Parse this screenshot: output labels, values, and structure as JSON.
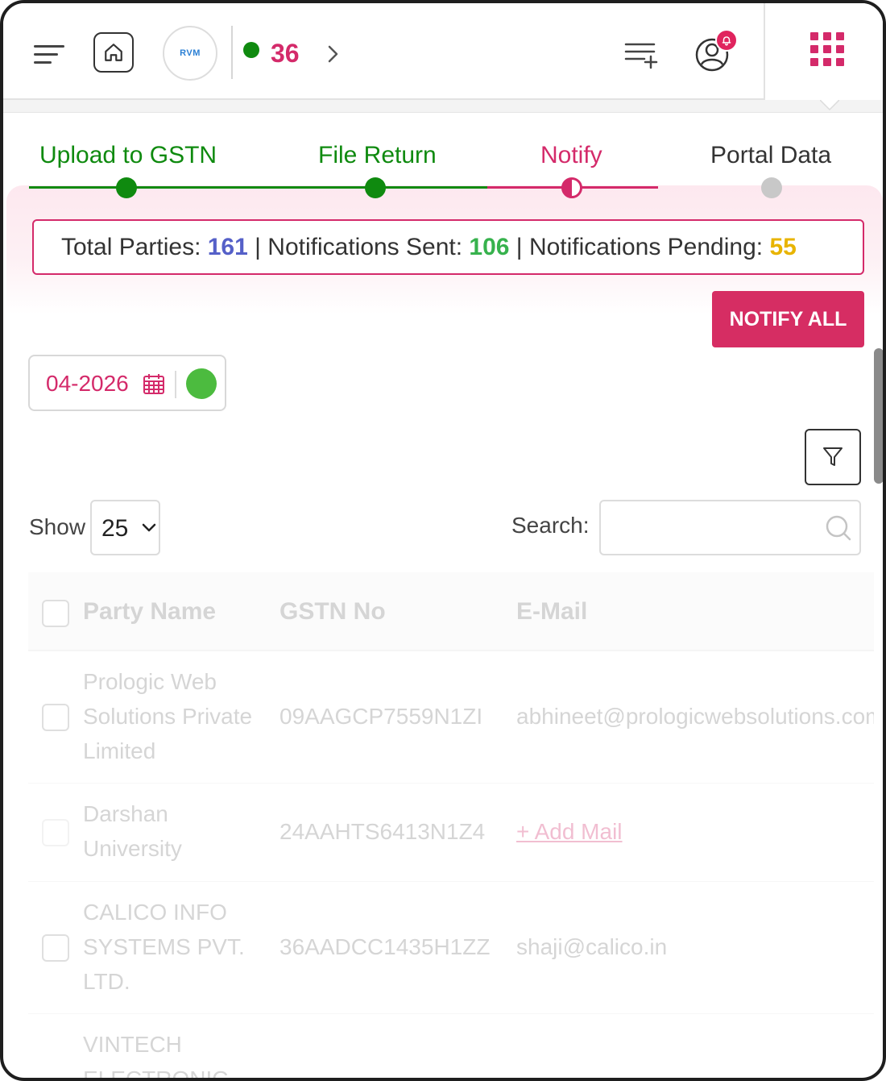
{
  "header": {
    "logo_text": "RVM",
    "count": "36",
    "icons": [
      "hamburger-icon",
      "home-icon",
      "chevron-right-icon",
      "list-add-icon",
      "user-icon",
      "bell-icon",
      "apps-grid-icon"
    ]
  },
  "stepper": {
    "steps": [
      {
        "label": "Upload to GSTN",
        "state": "done"
      },
      {
        "label": "File Return",
        "state": "done"
      },
      {
        "label": "Notify",
        "state": "active"
      },
      {
        "label": "Portal Data",
        "state": "pending"
      }
    ],
    "colors": {
      "done": "#0f8a0f",
      "active": "#d42a6a",
      "pending": "#c8c8c8"
    }
  },
  "summary": {
    "total_label": "Total Parties: ",
    "total_value": "161",
    "sep1": " | ",
    "sent_label": "Notifications Sent: ",
    "sent_value": "106",
    "sep2": " | ",
    "pending_label": "Notifications Pending: ",
    "pending_value": "55"
  },
  "actions": {
    "notify_all": "NOTIFY ALL"
  },
  "period": {
    "value": "04-2026",
    "status_color": "#4cbb3f"
  },
  "table_controls": {
    "show_label": "Show",
    "show_value": "25",
    "search_label": "Search:",
    "search_value": ""
  },
  "table": {
    "headers": [
      "Party Name",
      "GSTN No",
      "E-Mail"
    ],
    "rows": [
      {
        "party": "Prologic Web Solutions Private Limited",
        "gstn": "09AAGCP7559N1ZI",
        "email": "abhineet@prologicwebsolutions.com"
      },
      {
        "party": "Darshan University",
        "gstn": "24AAHTS6413N1Z4",
        "email": "",
        "add_mail": "+ Add Mail"
      },
      {
        "party": "CALICO INFO SYSTEMS PVT. LTD.",
        "gstn": "36AADCC1435H1ZZ",
        "email": "shaji@calico.in"
      },
      {
        "party": "VINTECH ELECTRONIC",
        "gstn": "",
        "email": ""
      }
    ]
  },
  "accent_color": "#d42a6a"
}
